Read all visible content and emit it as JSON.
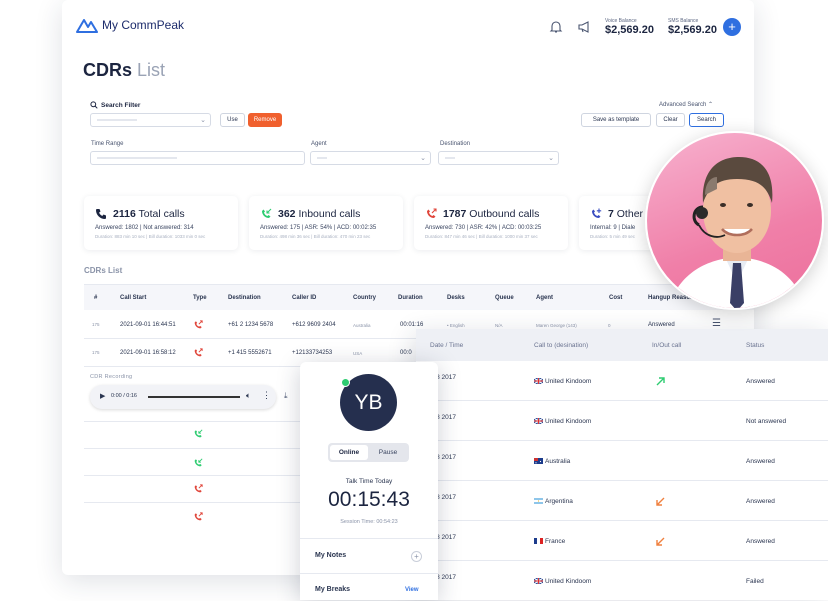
{
  "app": {
    "name": "My CommPeak"
  },
  "header": {
    "voice_balance_label": "Voice Balance",
    "voice_balance": "$2,569.20",
    "sms_balance_label": "SMS Balance",
    "sms_balance": "$2,569.20",
    "add_label": "+"
  },
  "page": {
    "title_bold": "CDRs",
    "title_light": "List"
  },
  "filter": {
    "search_filter_label": "Search Filter",
    "use_label": "Use",
    "remove_label": "Remove",
    "advanced_search_label": "Advanced Search",
    "save_template_label": "Save as template",
    "clear_label": "Clear",
    "search_label": "Search",
    "time_range_label": "Time Range",
    "agent_label": "Agent",
    "destination_label": "Destination"
  },
  "stats": [
    {
      "count": "2116",
      "label": "Total calls",
      "line1": "Answered: 1802 | Not answered: 314",
      "line2": "Duration: 883 min 10 sec | Bill duration: 1033 min 0 sec"
    },
    {
      "count": "362",
      "label": "Inbound calls",
      "line1": "Answered: 175 | ASR: 54% | ACD: 00:02:35",
      "line2": "Duration: 498 min 36 sec | Bill duration: 470 min 23 sec"
    },
    {
      "count": "1787",
      "label": "Outbound calls",
      "line1": "Answered: 730 | ASR: 42% | ACD: 00:03:25",
      "line2": "Duration: 847 min 46 sec | Bill duration: 1000 min 37 sec"
    },
    {
      "count": "7",
      "label": "Other",
      "line1": "Internal: 9 | Diale",
      "line2": "Duration: 5 min 49 sec"
    }
  ],
  "cdrs_list_label": "CDRs List",
  "table": {
    "headers": [
      "#",
      "Call Start",
      "Type",
      "Destination",
      "Caller ID",
      "Country",
      "Duration",
      "Desks",
      "Queue",
      "Agent",
      "Cost",
      "Hangup Reason"
    ],
    "rows": [
      {
        "num": "175",
        "start": "2021-09-01 16:44:51",
        "dest": "+61 2 1234 5678",
        "caller": "+612 9609 2404",
        "country": "Australia",
        "duration": "00:01:16",
        "desk": "• English",
        "queue": "N/A",
        "agent": "Maren George (143)",
        "cost": "0",
        "hangup": "Answered"
      },
      {
        "num": "175",
        "start": "2021-09-01 16:58:12",
        "dest": "+1 415 5552671",
        "caller": "+12133734253",
        "country": "USA",
        "duration": "00:0"
      }
    ]
  },
  "recording": {
    "label": "CDR Recording",
    "time": "0:00 / 0:16"
  },
  "calls_table": {
    "headers": [
      "Date / Time",
      "Call to (desination)",
      "In/Out call",
      "Status"
    ],
    "rows": [
      {
        "date": "N 28 2017",
        "sub": "03",
        "dest": "United Kindoom",
        "status": "Answered"
      },
      {
        "date": "N 28 2017",
        "sub": "03",
        "dest": "United Kindoom",
        "status": "Not answered"
      },
      {
        "date": "N 28 2017",
        "sub": "03",
        "dest": "Australia",
        "status": "Answered"
      },
      {
        "date": "N 28 2017",
        "sub": "03",
        "dest": "Argentina",
        "status": "Answered"
      },
      {
        "date": "N 28 2017",
        "sub": "03",
        "dest": "France",
        "status": "Answered"
      },
      {
        "date": "N 28 2017",
        "sub": "03",
        "dest": "United Kindoom",
        "status": "Failed"
      }
    ]
  },
  "agent": {
    "initials": "YB",
    "online_label": "Online",
    "pause_label": "Pause",
    "talk_time_label": "Talk Time Today",
    "talk_time": "00:15:43",
    "session_time": "Session Time: 00:54:23",
    "notes_label": "My Notes",
    "breaks_label": "My Breaks",
    "view_label": "View"
  },
  "colors": {
    "accent": "#2f6fe0",
    "danger": "#f0602e",
    "inbound": "#2ecc71",
    "outbound": "#e0453a"
  }
}
